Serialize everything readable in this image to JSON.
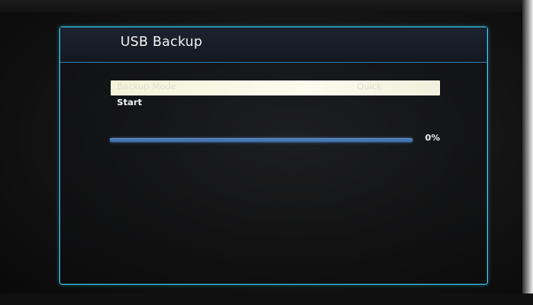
{
  "dialog": {
    "title": "USB Backup",
    "menu": {
      "selected_label": "Backup Mode",
      "selected_value": "Quick",
      "start_label": "Start"
    },
    "progress": {
      "percent_text": "0%",
      "fraction": 0.0
    }
  },
  "colors": {
    "frame_accent": "#39c3ea",
    "selected_row": "#f4f2d8",
    "progress_track": "#4a78b0"
  }
}
